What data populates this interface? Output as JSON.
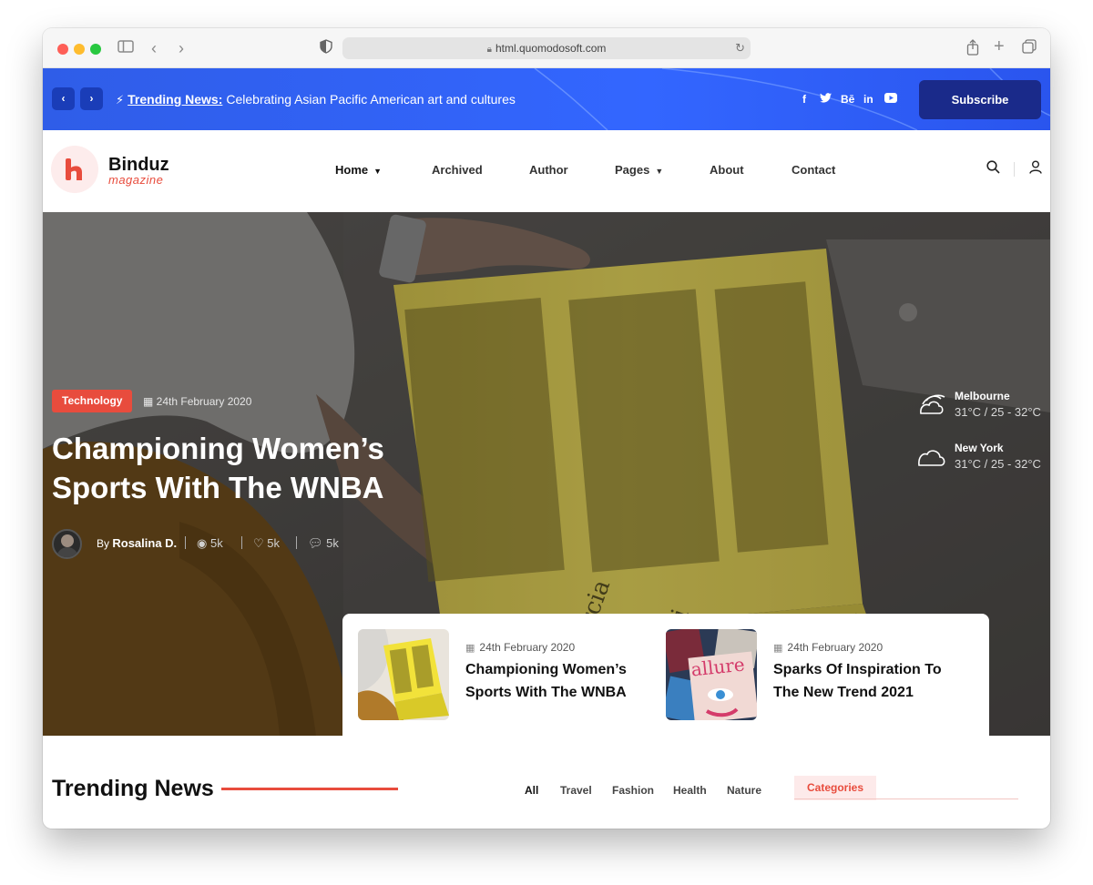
{
  "browser": {
    "url": "html.quomodosoft.com"
  },
  "topbar": {
    "trending_label": "Trending News:",
    "trending_text": "Celebrating Asian Pacific American art and cultures",
    "social": [
      "f",
      "𝕥",
      "Bē",
      "in",
      "▶"
    ],
    "subscribe_label": "Subscribe"
  },
  "logo": {
    "name": "Binduz",
    "sub": "magazine"
  },
  "nav": {
    "items": [
      {
        "label": "Home",
        "dropdown": true,
        "active": true
      },
      {
        "label": "Archived"
      },
      {
        "label": "Author"
      },
      {
        "label": "Pages",
        "dropdown": true
      },
      {
        "label": "About"
      },
      {
        "label": "Contact"
      }
    ]
  },
  "hero": {
    "category": "Technology",
    "date": "24th February 2020",
    "title": "Championing Women’s Sports With The WNBA",
    "author_prefix": "By",
    "author": "Rosalina D.",
    "views": "5k",
    "likes": "5k",
    "comments": "5k",
    "weather": [
      {
        "city": "Melbourne",
        "temp": "31°C / 25 - 32°C",
        "icon": "wind-cloud-icon"
      },
      {
        "city": "New York",
        "temp": "31°C / 25 - 32°C",
        "icon": "cloud-icon"
      }
    ]
  },
  "featured": [
    {
      "date": "24th February 2020",
      "title": "Championing Women’s Sports With The WNBA"
    },
    {
      "date": "24th February 2020",
      "title": "Sparks Of Inspiration To The New Trend 2021"
    }
  ],
  "trending": {
    "title": "Trending News",
    "filters": [
      "All",
      "Travel",
      "Fashion",
      "Health",
      "Nature"
    ],
    "categories_label": "Categories"
  },
  "colors": {
    "accent": "#e84c3d",
    "topbar": "#3366ff",
    "subscribe": "#1a2a8a"
  }
}
